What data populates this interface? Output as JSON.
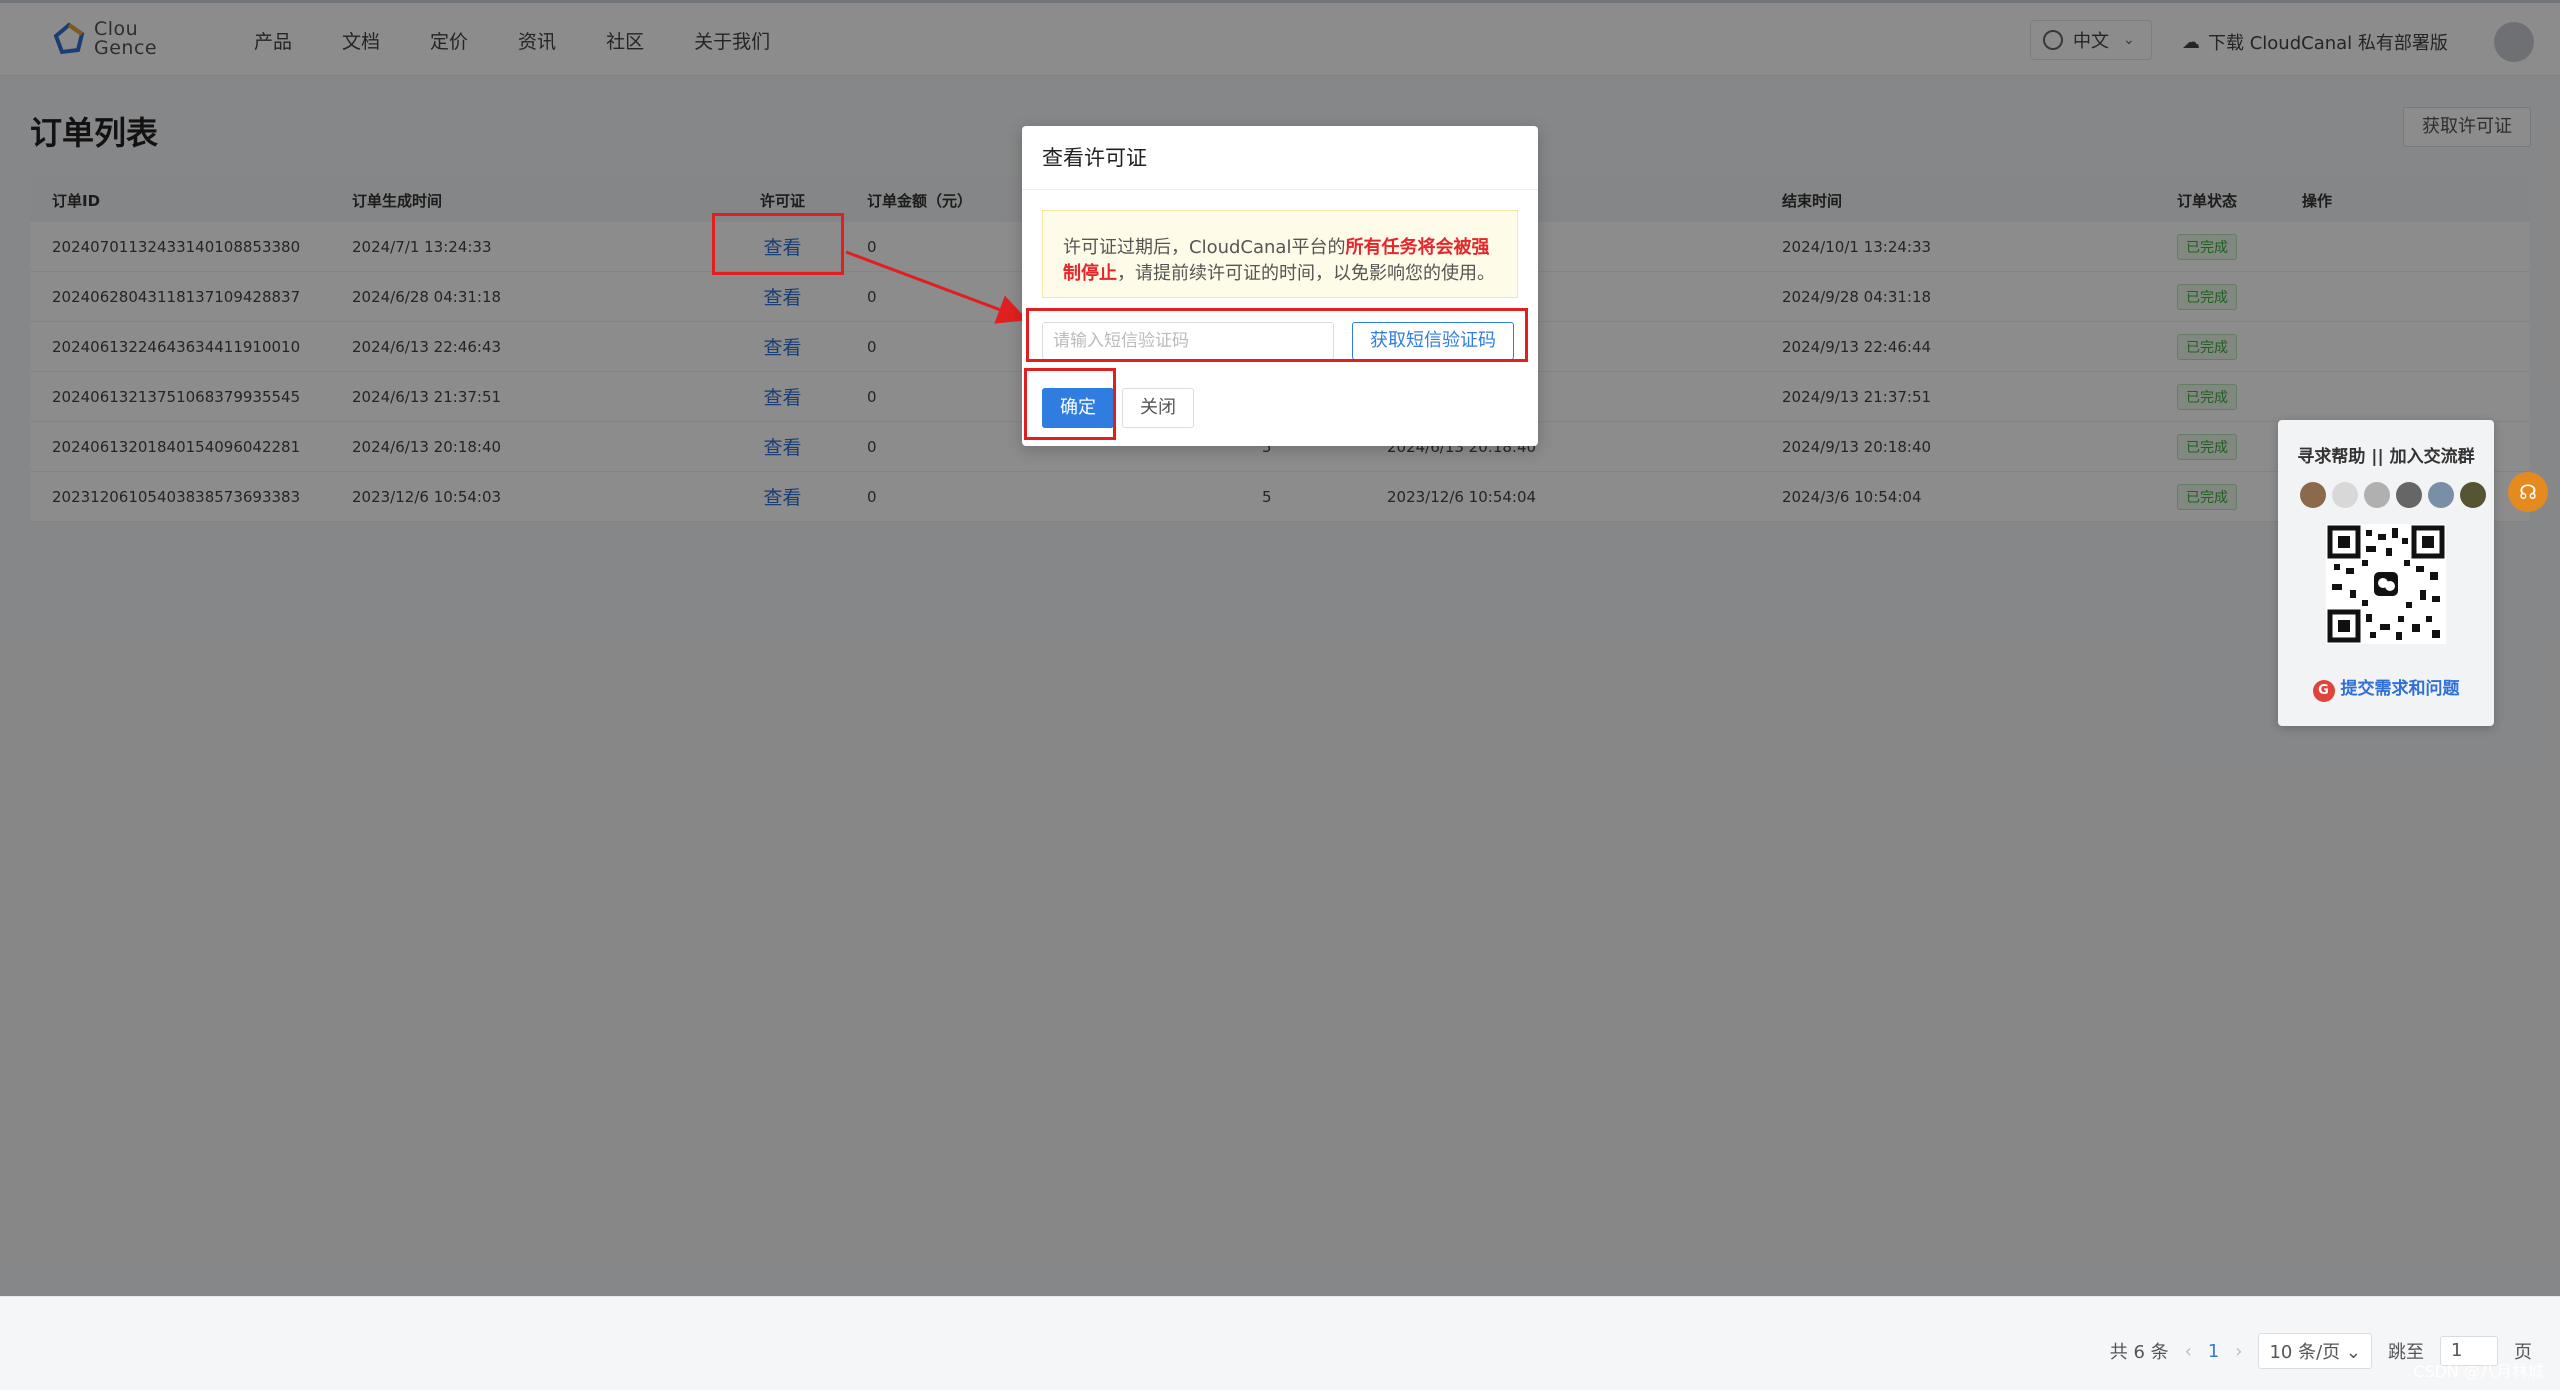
{
  "header": {
    "logo_text_1": "Clou",
    "logo_text_2": "Gence",
    "nav": [
      "产品",
      "文档",
      "定价",
      "资讯",
      "社区",
      "关于我们"
    ],
    "lang": "中文",
    "download": "下载 CloudCanal 私有部署版"
  },
  "page": {
    "title": "订单列表",
    "get_license_button": "获取许可证"
  },
  "table": {
    "columns": [
      "订单ID",
      "订单生成时间",
      "许可证",
      "订单金额（元）",
      "",
      "",
      "结束时间",
      "订单状态",
      "操作"
    ],
    "view_label": "查看",
    "rows": [
      {
        "id": "20240701132433140108853380",
        "gen": "2024/7/1 13:24:33",
        "amount": "0",
        "mid": "",
        "start": "",
        "end": "2024/10/1 13:24:33",
        "status": "已完成"
      },
      {
        "id": "20240628043118137109428837",
        "gen": "2024/6/28 04:31:18",
        "amount": "0",
        "mid": "",
        "start": "",
        "end": "2024/9/28 04:31:18",
        "status": "已完成"
      },
      {
        "id": "20240613224643634411910010",
        "gen": "2024/6/13 22:46:43",
        "amount": "0",
        "mid": "",
        "start": "",
        "end": "2024/9/13 22:46:44",
        "status": "已完成"
      },
      {
        "id": "20240613213751068379935545",
        "gen": "2024/6/13 21:37:51",
        "amount": "0",
        "mid": "",
        "start": "",
        "end": "2024/9/13 21:37:51",
        "status": "已完成"
      },
      {
        "id": "20240613201840154096042281",
        "gen": "2024/6/13 20:18:40",
        "amount": "0",
        "mid": "5",
        "start": "2024/6/13 20:18:40",
        "end": "2024/9/13 20:18:40",
        "status": "已完成"
      },
      {
        "id": "20231206105403838573693383",
        "gen": "2023/12/6 10:54:03",
        "amount": "0",
        "mid": "5",
        "start": "2023/12/6 10:54:04",
        "end": "2024/3/6 10:54:04",
        "status": "已完成"
      }
    ]
  },
  "modal": {
    "title": "查看许可证",
    "alert_text_1": "许可证过期后，CloudCanal平台的",
    "alert_warn": "所有任务将会被强制停止",
    "alert_text_2": "，请提前续许可证的时间，以免影响您的使用。",
    "sms_placeholder": "请输入短信验证码",
    "sms_button": "获取短信验证码",
    "ok_button": "确定",
    "close_button": "关闭"
  },
  "footer": {
    "total": "共 6 条",
    "current_page": "1",
    "page_size": "10 条/页",
    "jump_label": "跳至",
    "jump_value": "1",
    "page_suffix": "页"
  },
  "help": {
    "title": "寻求帮助 || 加入交流群",
    "link": "提交需求和问题"
  },
  "watermark": "CSDN @八月林城",
  "colors": {
    "primary": "#2f7de1",
    "annotation": "#e02020",
    "success": "#3fae3f"
  }
}
